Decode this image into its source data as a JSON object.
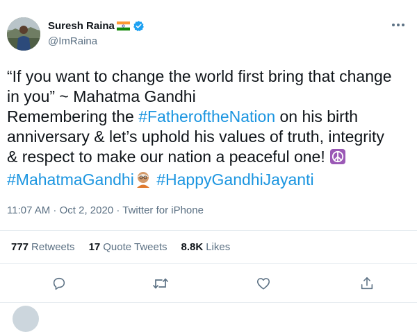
{
  "author": {
    "name": "Suresh Raina",
    "handle": "@ImRaina"
  },
  "tweet": {
    "line1": "“If you want to change the world first bring that change",
    "line2": "in you” ~ Mahatma Gandhi",
    "line3_prefix": "Remembering the ",
    "line3_hashtag": "#FatheroftheNation",
    "line3_suffix": " on his birth",
    "line4": "anniversary & let’s uphold his values of truth, integrity",
    "line5": "& respect to make our nation a peaceful one! ",
    "hashtag_mahatma": "#MahatmaGandhi",
    "hashtag_jayanti": "#HappyGandhiJayanti"
  },
  "meta": {
    "time": "11:07 AM",
    "separator1": " · ",
    "date": "Oct 2, 2020",
    "separator2": " · ",
    "source": "Twitter for iPhone"
  },
  "stats": {
    "retweets_count": "777",
    "retweets_label": "Retweets",
    "quotes_count": "17",
    "quotes_label": "Quote Tweets",
    "likes_count": "8.8K",
    "likes_label": "Likes"
  },
  "icons": {
    "flag": "india-flag-icon",
    "verified": "verified-badge-icon",
    "more": "more-options-icon",
    "reply": "reply-icon",
    "retweet": "retweet-icon",
    "like": "heart-icon",
    "share": "share-icon",
    "peace": "peace-symbol-icon",
    "gandhi": "gandhi-emoji-icon"
  },
  "colors": {
    "hashtag": "#1b95e0",
    "verified": "#1da1f2",
    "secondary_text": "#5b7083",
    "peace_bg": "#9b59b6"
  }
}
